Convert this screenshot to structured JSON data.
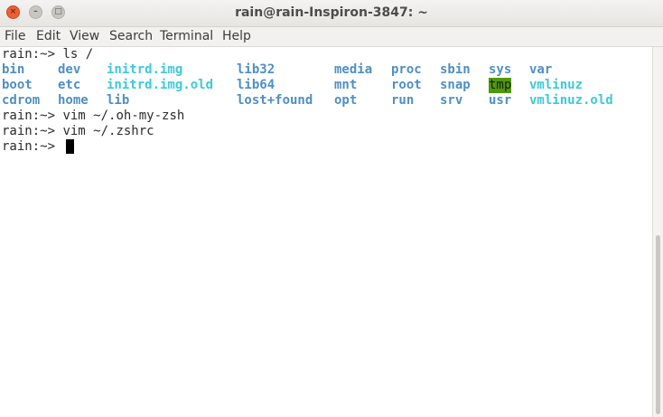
{
  "window": {
    "title": "rain@rain-Inspiron-3847: ~",
    "close_glyph": "×",
    "min_glyph": "–",
    "max_glyph": "□"
  },
  "menu": [
    "File",
    "Edit",
    "View",
    "Search",
    "Terminal",
    "Help"
  ],
  "terminal": {
    "prompt": "rain:~>",
    "commands": [
      "ls /",
      "vim ~/.oh-my-zsh",
      "vim ~/.zshrc"
    ],
    "listing": [
      [
        {
          "text": "bin",
          "kind": "dir"
        },
        {
          "text": "dev",
          "kind": "dir"
        },
        {
          "text": "initrd.img",
          "kind": "link"
        },
        {
          "text": "lib32",
          "kind": "dir"
        },
        {
          "text": "media",
          "kind": "dir"
        },
        {
          "text": "proc",
          "kind": "dir"
        },
        {
          "text": "sbin",
          "kind": "dir"
        },
        {
          "text": "sys",
          "kind": "dir"
        },
        {
          "text": "var",
          "kind": "dir"
        }
      ],
      [
        {
          "text": "boot",
          "kind": "dir"
        },
        {
          "text": "etc",
          "kind": "dir"
        },
        {
          "text": "initrd.img.old",
          "kind": "link"
        },
        {
          "text": "lib64",
          "kind": "dir"
        },
        {
          "text": "mnt",
          "kind": "dir"
        },
        {
          "text": "root",
          "kind": "dir"
        },
        {
          "text": "snap",
          "kind": "dir"
        },
        {
          "text": "tmp",
          "kind": "sticky"
        },
        {
          "text": "vmlinuz",
          "kind": "link"
        }
      ],
      [
        {
          "text": "cdrom",
          "kind": "dir"
        },
        {
          "text": "home",
          "kind": "dir"
        },
        {
          "text": "lib",
          "kind": "dir"
        },
        {
          "text": "lost+found",
          "kind": "dir"
        },
        {
          "text": "opt",
          "kind": "dir"
        },
        {
          "text": "run",
          "kind": "dir"
        },
        {
          "text": "srv",
          "kind": "dir"
        },
        {
          "text": "usr",
          "kind": "dir"
        },
        {
          "text": "vmlinuz.old",
          "kind": "link"
        }
      ]
    ]
  },
  "colors": {
    "directory": "#4f8fc2",
    "symlink": "#3ec9d8",
    "sticky_bg": "#4e9a06",
    "close_button": "#ee5f32"
  }
}
